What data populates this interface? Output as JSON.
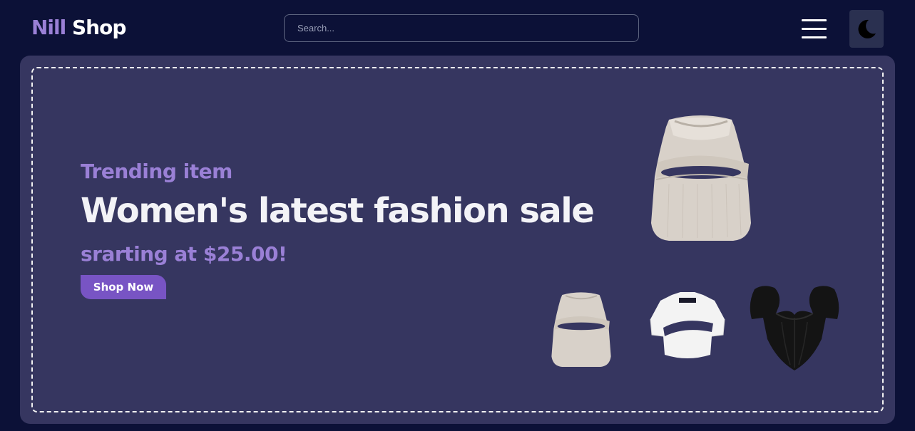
{
  "header": {
    "logo_first": "Nill",
    "logo_second": "Shop",
    "search_placeholder": "Search..."
  },
  "icons": {
    "menu": "hamburger-menu-icon",
    "theme": "moon-icon"
  },
  "hero": {
    "subtitle": "Trending item",
    "headline": "Women's latest fashion sale",
    "price_text": "srarting at $25.00!",
    "cta_label": "Shop Now"
  },
  "products": [
    {
      "name": "beige cutout tank top"
    },
    {
      "name": "beige cutout tank top"
    },
    {
      "name": "white cutout crop top"
    },
    {
      "name": "black corset top"
    }
  ],
  "colors": {
    "background": "#0c1137",
    "banner": "#363660",
    "accent": "#9a80d6",
    "button": "#7854c4"
  }
}
